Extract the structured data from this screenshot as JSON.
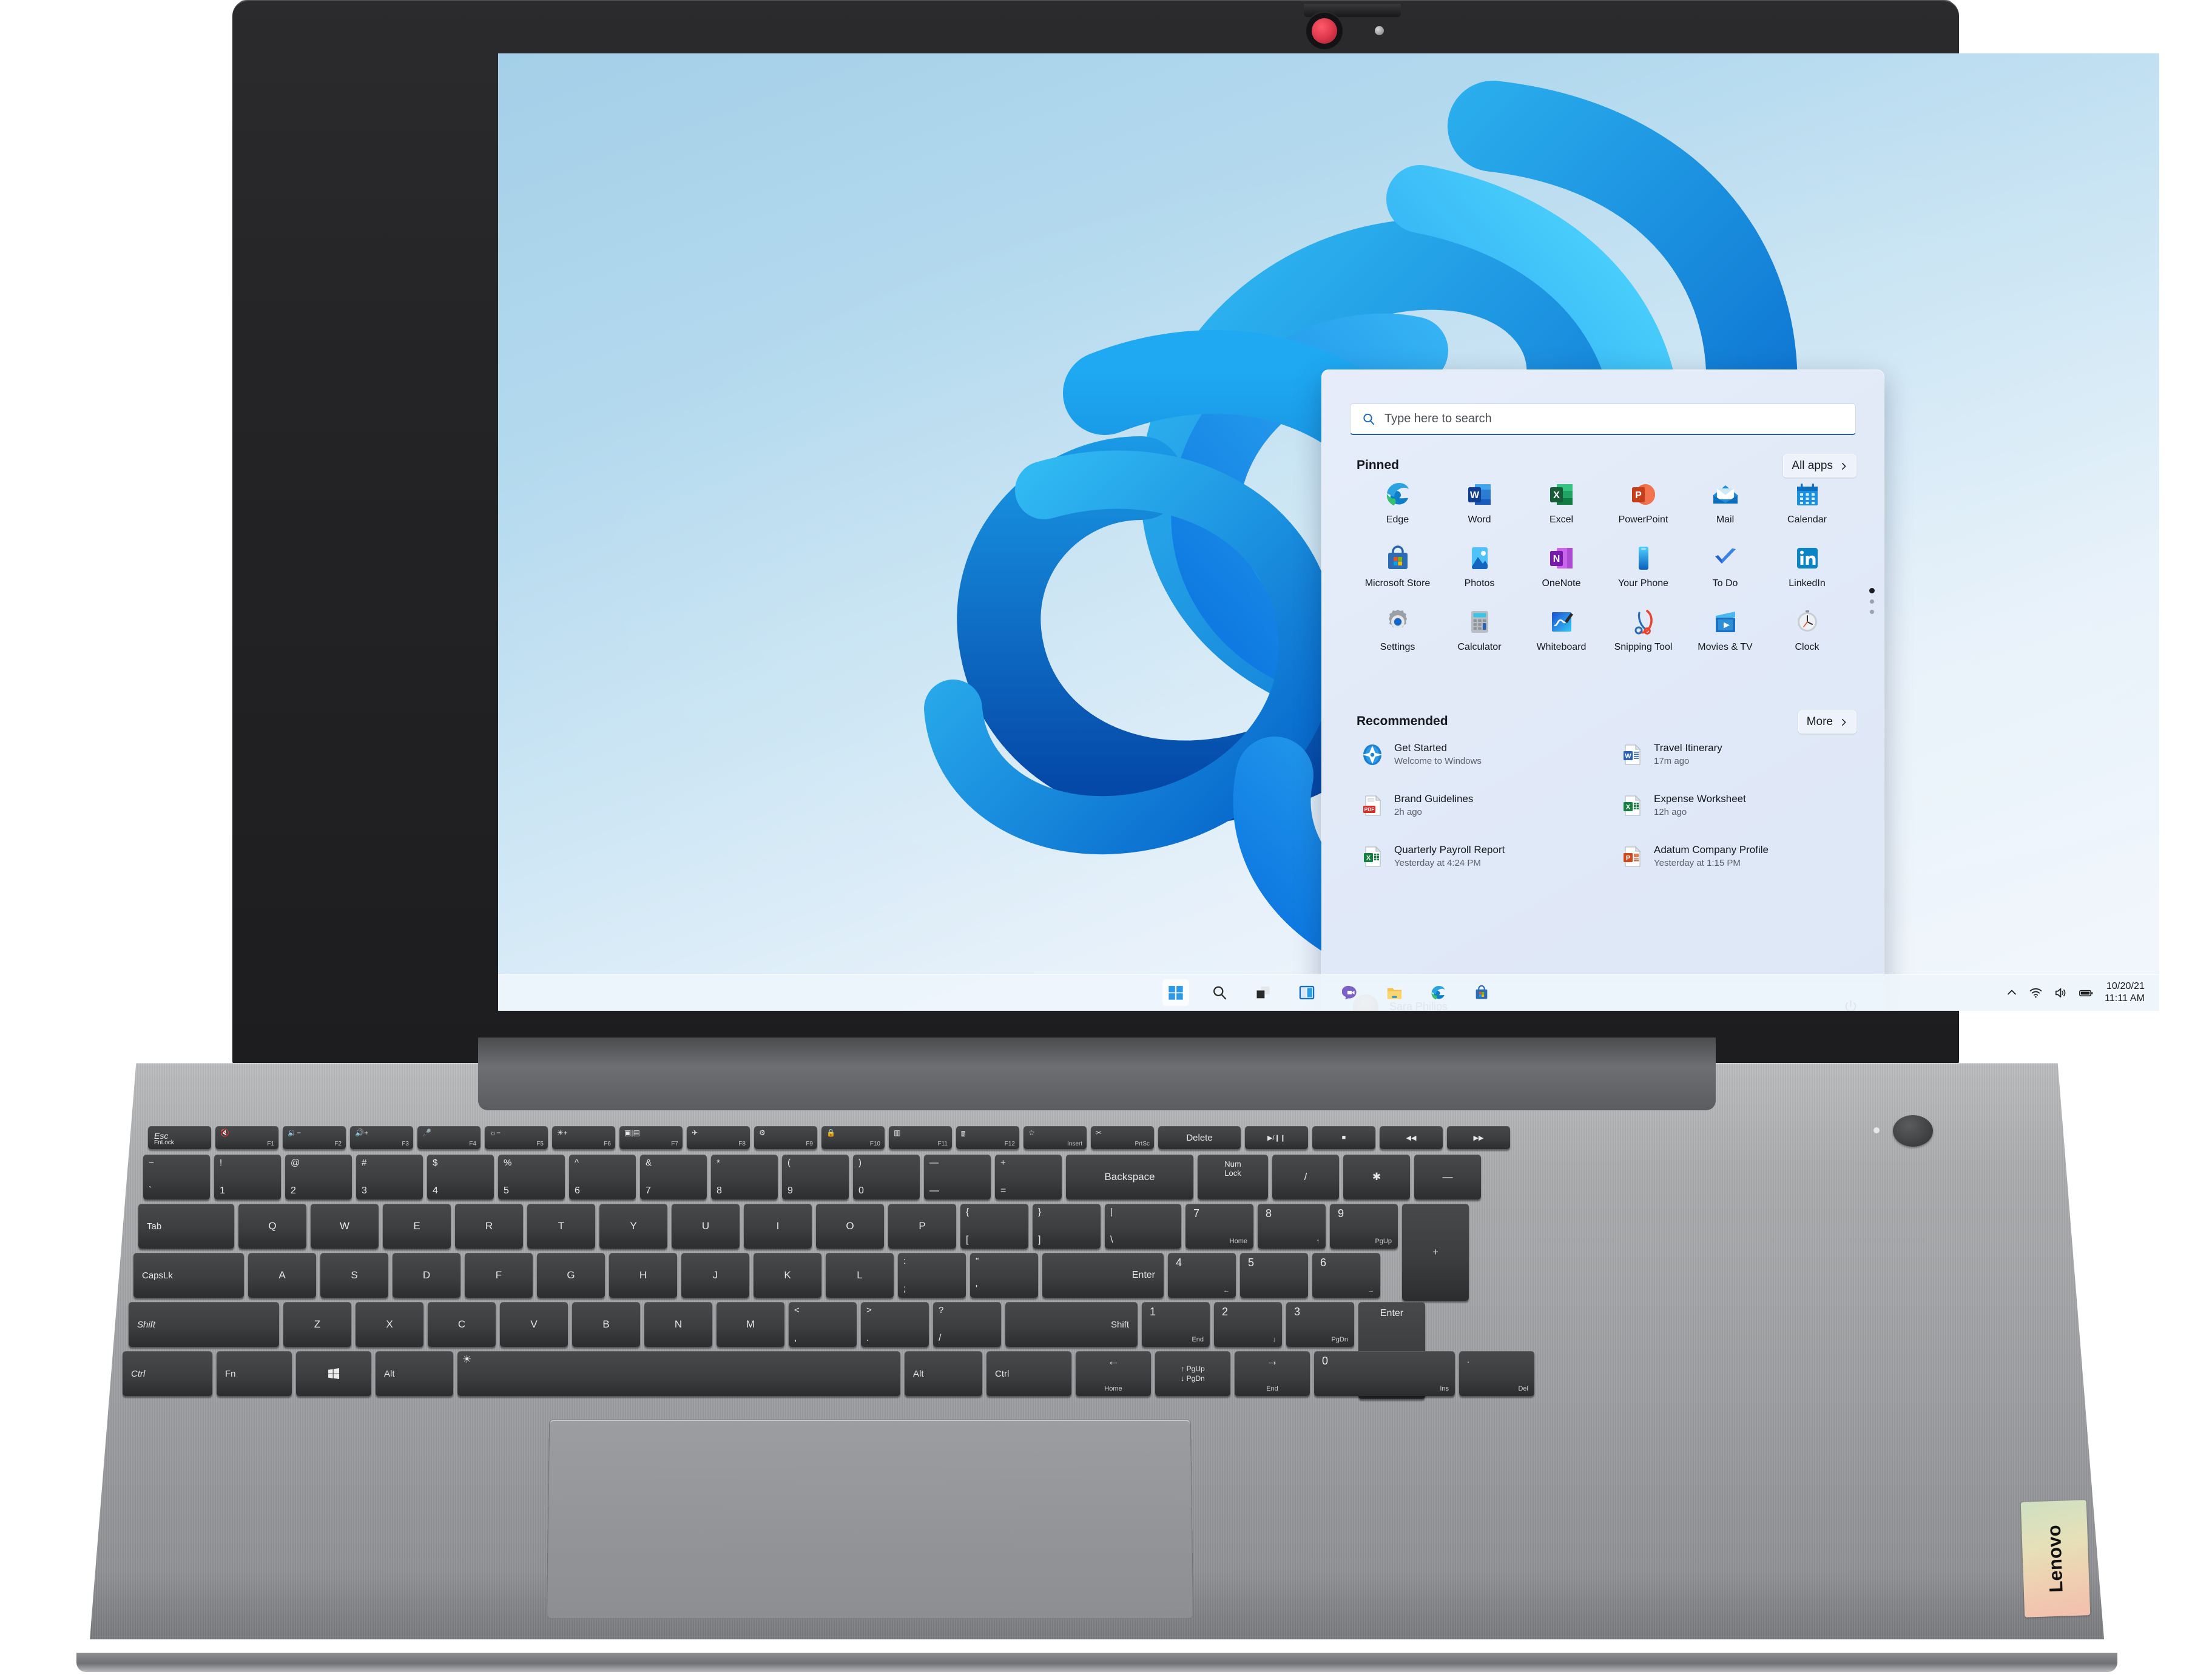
{
  "device": {
    "brand": "Lenovo"
  },
  "desktop": {
    "taskbar": {
      "items": [
        {
          "name": "start-button",
          "label": "Start"
        },
        {
          "name": "search-icon",
          "label": "Search"
        },
        {
          "name": "task-view-icon",
          "label": "Task View"
        },
        {
          "name": "widgets-icon",
          "label": "Widgets"
        },
        {
          "name": "chat-icon",
          "label": "Chat"
        },
        {
          "name": "file-explorer-icon",
          "label": "File Explorer"
        },
        {
          "name": "edge-icon",
          "label": "Microsoft Edge"
        },
        {
          "name": "store-icon",
          "label": "Microsoft Store"
        }
      ],
      "tray": {
        "chevron": "show-hidden-icons",
        "wifi": "wifi-icon",
        "volume": "volume-icon",
        "battery": "battery-icon",
        "date": "10/20/21",
        "time": "11:11 AM"
      }
    }
  },
  "start_menu": {
    "search": {
      "placeholder": "Type here to search",
      "value": ""
    },
    "pinned": {
      "heading": "Pinned",
      "all_apps_label": "All apps",
      "apps": [
        {
          "label": "Edge",
          "icon": "edge-icon"
        },
        {
          "label": "Word",
          "icon": "word-icon"
        },
        {
          "label": "Excel",
          "icon": "excel-icon"
        },
        {
          "label": "PowerPoint",
          "icon": "powerpoint-icon"
        },
        {
          "label": "Mail",
          "icon": "mail-icon"
        },
        {
          "label": "Calendar",
          "icon": "calendar-icon"
        },
        {
          "label": "Microsoft Store",
          "icon": "store-icon"
        },
        {
          "label": "Photos",
          "icon": "photos-icon"
        },
        {
          "label": "OneNote",
          "icon": "onenote-icon"
        },
        {
          "label": "Your Phone",
          "icon": "your-phone-icon"
        },
        {
          "label": "To Do",
          "icon": "to-do-icon"
        },
        {
          "label": "LinkedIn",
          "icon": "linkedin-icon"
        },
        {
          "label": "Settings",
          "icon": "settings-icon"
        },
        {
          "label": "Calculator",
          "icon": "calculator-icon"
        },
        {
          "label": "Whiteboard",
          "icon": "whiteboard-icon"
        },
        {
          "label": "Snipping Tool",
          "icon": "snipping-tool-icon"
        },
        {
          "label": "Movies & TV",
          "icon": "movies-tv-icon"
        },
        {
          "label": "Clock",
          "icon": "clock-icon"
        }
      ],
      "page_count": 3,
      "current_page": 1
    },
    "recommended": {
      "heading": "Recommended",
      "more_label": "More",
      "items": [
        {
          "title": "Get Started",
          "subtitle": "Welcome to Windows",
          "icon": "get-started-icon"
        },
        {
          "title": "Travel Itinerary",
          "subtitle": "17m ago",
          "icon": "word-doc-icon"
        },
        {
          "title": "Brand Guidelines",
          "subtitle": "2h ago",
          "icon": "pdf-doc-icon"
        },
        {
          "title": "Expense Worksheet",
          "subtitle": "12h ago",
          "icon": "excel-doc-icon"
        },
        {
          "title": "Quarterly Payroll Report",
          "subtitle": "Yesterday at 4:24 PM",
          "icon": "excel-doc-icon"
        },
        {
          "title": "Adatum Company Profile",
          "subtitle": "Yesterday at 1:15 PM",
          "icon": "powerpoint-doc-icon"
        }
      ]
    },
    "account": {
      "name": "Sara Philips",
      "power_label": "Power"
    }
  },
  "keyboard": {
    "fn_row": [
      {
        "top": "Esc",
        "sub": "FnLock",
        "kind": "esc"
      },
      {
        "glyph": "mute-icon",
        "sub": "F1"
      },
      {
        "glyph": "volume-down-icon",
        "sub": "F2"
      },
      {
        "glyph": "volume-up-icon",
        "sub": "F3"
      },
      {
        "glyph": "mic-mute-icon",
        "sub": "F4"
      },
      {
        "glyph": "brightness-down-icon",
        "sub": "F5"
      },
      {
        "glyph": "brightness-up-icon",
        "sub": "F6"
      },
      {
        "glyph": "display-switch-icon",
        "sub": "F7"
      },
      {
        "glyph": "airplane-mode-icon",
        "sub": "F8"
      },
      {
        "glyph": "settings-icon",
        "sub": "F9"
      },
      {
        "glyph": "lock-icon",
        "sub": "F10"
      },
      {
        "glyph": "task-view-icon",
        "sub": "F11"
      },
      {
        "glyph": "calculator-icon",
        "sub": "F12"
      },
      {
        "glyph": "favorites-icon",
        "sub": "Insert"
      },
      {
        "glyph": "snip-icon",
        "sub": "PrtSc"
      },
      {
        "top": "Delete",
        "kind": "wide"
      },
      {
        "glyph": "play-pause-icon"
      },
      {
        "glyph": "stop-icon"
      },
      {
        "glyph": "previous-track-icon"
      },
      {
        "glyph": "next-track-icon"
      }
    ],
    "number_row": [
      {
        "up": "~",
        "dn": "`"
      },
      {
        "up": "!",
        "dn": "1"
      },
      {
        "up": "@",
        "dn": "2"
      },
      {
        "up": "#",
        "dn": "3"
      },
      {
        "up": "$",
        "dn": "4"
      },
      {
        "up": "%",
        "dn": "5"
      },
      {
        "up": "^",
        "dn": "6"
      },
      {
        "up": "&",
        "dn": "7"
      },
      {
        "up": "*",
        "dn": "8"
      },
      {
        "up": "(",
        "dn": "9"
      },
      {
        "up": ")",
        "dn": "0"
      },
      {
        "up": "—",
        "dn": "—"
      },
      {
        "up": "+",
        "dn": "="
      }
    ],
    "backspace": "Backspace",
    "numlock": "Num\nLock",
    "top_row": [
      "Tab",
      "Q",
      "W",
      "E",
      "R",
      "T",
      "Y",
      "U",
      "I",
      "O",
      "P",
      "{",
      "}",
      "|"
    ],
    "home_row": [
      "CapsLk",
      "A",
      "S",
      "D",
      "F",
      "G",
      "H",
      "J",
      "K",
      "L",
      ":",
      ";",
      "\"",
      "'",
      "Enter"
    ],
    "bottom_row": [
      "Shift",
      "Z",
      "X",
      "C",
      "V",
      "B",
      "N",
      "M",
      "<",
      ">",
      "?",
      "Shift"
    ],
    "modifier_row": [
      "Ctrl",
      "Fn",
      "Windows",
      "Alt",
      "Space",
      "Alt",
      "Ctrl"
    ],
    "arrows": [
      {
        "main": "left-arrow-icon",
        "sub": "Home"
      },
      {
        "main": "up-arrow-icon",
        "sub": "PgUp"
      },
      {
        "main": "down-arrow-icon",
        "sub": "PgDn"
      },
      {
        "main": "right-arrow-icon",
        "sub": "End"
      }
    ],
    "numpad": [
      {
        "main": "7",
        "sub": "Home"
      },
      {
        "main": "8",
        "sub": "up-arrow-icon"
      },
      {
        "main": "9",
        "sub": "PgUp"
      },
      {
        "main": "+",
        "sub": ""
      },
      {
        "main": "4",
        "sub": "left-arrow-icon"
      },
      {
        "main": "5",
        "sub": ""
      },
      {
        "main": "6",
        "sub": "right-arrow-icon"
      },
      {
        "main": "1",
        "sub": "End"
      },
      {
        "main": "2",
        "sub": "down-arrow-icon"
      },
      {
        "main": "3",
        "sub": "PgDn"
      },
      {
        "main": "Enter",
        "sub": ""
      },
      {
        "main": "0",
        "sub": "Ins"
      },
      {
        "main": ".",
        "sub": "Del"
      },
      {
        "main": "/",
        "sub": ""
      },
      {
        "main": "*",
        "sub": ""
      },
      {
        "main": "—",
        "sub": ""
      }
    ]
  }
}
